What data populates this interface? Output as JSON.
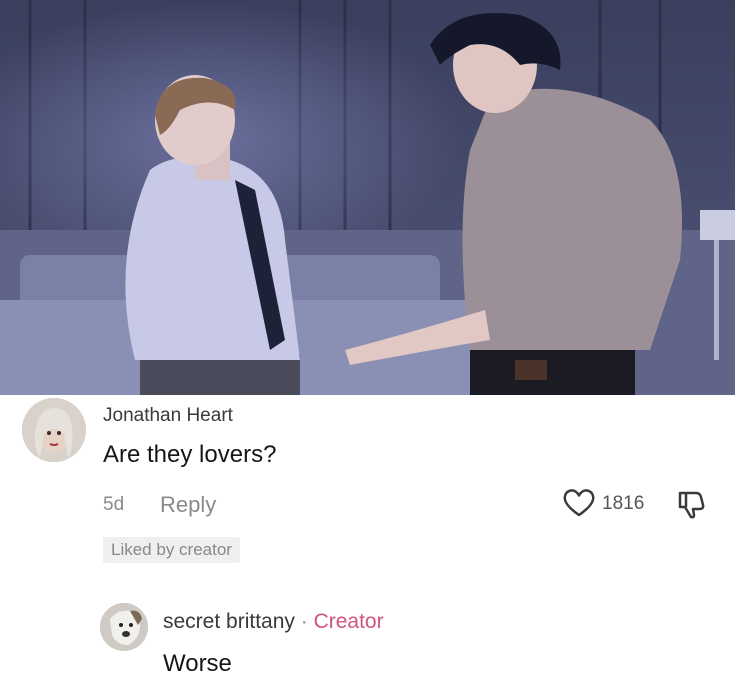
{
  "comment": {
    "author": "Jonathan Heart",
    "text": "Are they lovers?",
    "age": "5d",
    "reply_label": "Reply",
    "like_count": "1816",
    "liked_by_badge": "Liked by creator",
    "like_icon": "heart-outline-icon",
    "dislike_icon": "thumbs-down-icon"
  },
  "reply": {
    "author": "secret brittany",
    "separator": "·",
    "role_badge": "Creator",
    "text": "Worse"
  },
  "colors": {
    "creator_accent": "#d0547f",
    "meta_text": "#8a8a8a",
    "liked_badge_bg": "#efefef"
  }
}
